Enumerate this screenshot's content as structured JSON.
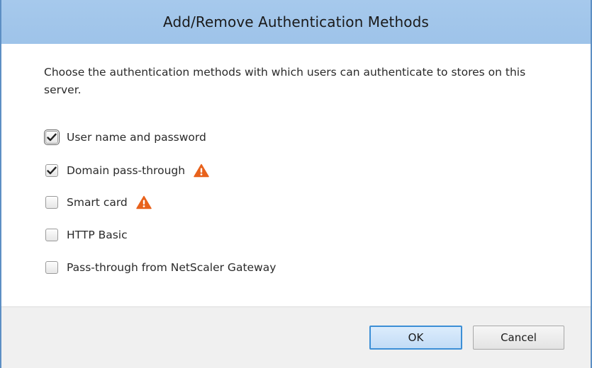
{
  "dialog": {
    "title": "Add/Remove Authentication Methods",
    "description": "Choose the authentication methods with which users can authenticate to stores on this server."
  },
  "options": [
    {
      "label": "User name and password",
      "checked": true,
      "warning": false
    },
    {
      "label": "Domain pass-through",
      "checked": true,
      "warning": true
    },
    {
      "label": "Smart card",
      "checked": false,
      "warning": true
    },
    {
      "label": "HTTP Basic",
      "checked": false,
      "warning": false
    },
    {
      "label": "Pass-through from NetScaler Gateway",
      "checked": false,
      "warning": false
    }
  ],
  "buttons": {
    "ok_label": "OK",
    "cancel_label": "Cancel"
  },
  "colors": {
    "title_bar": "#a6c9ec",
    "window_border": "#5d8fc4",
    "warning": "#e8621c",
    "ok_border": "#3c8fd6"
  },
  "icons": {
    "check": "check-icon",
    "warning": "warning-triangle-icon"
  }
}
